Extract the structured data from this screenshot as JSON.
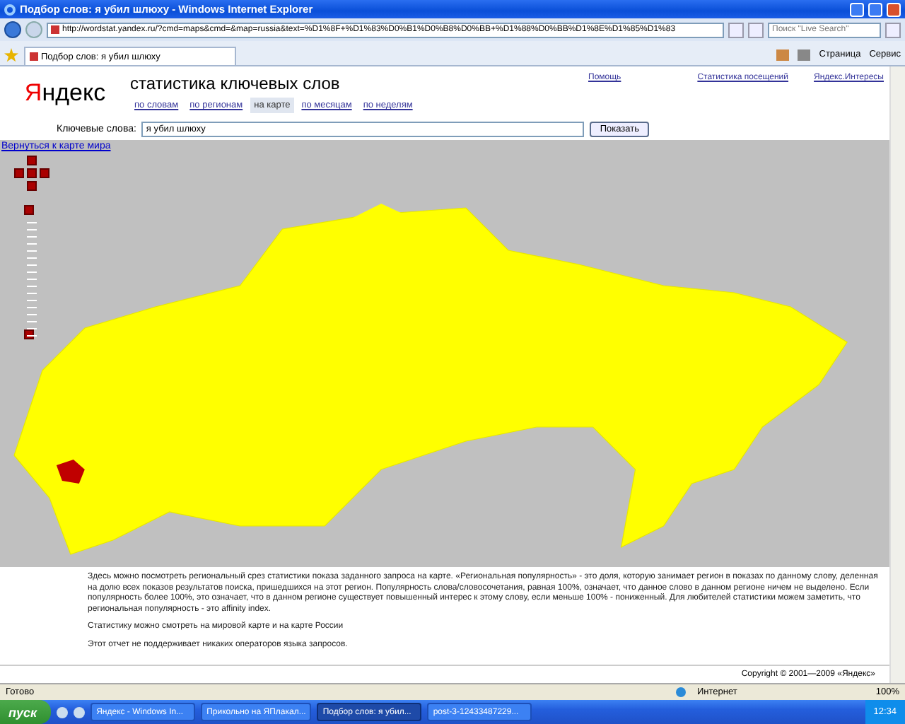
{
  "window": {
    "title": "Подбор слов: я убил шлюху - Windows Internet Explorer"
  },
  "address_bar": {
    "url": "http://wordstat.yandex.ru/?cmd=maps&cmd=&map=russia&text=%D1%8F+%D1%83%D0%B1%D0%B8%D0%BB+%D1%88%D0%BB%D1%8E%D1%85%D1%83",
    "search_placeholder": "Поиск \"Live Search\""
  },
  "tab": {
    "title": "Подбор слов: я убил шлюху"
  },
  "toolbar": {
    "items": [
      "Страница",
      "Сервис"
    ]
  },
  "page": {
    "logo": "Яндекс",
    "title": "статистика ключевых слов",
    "top_links": [
      "Помощь",
      "Статистика посещений",
      "Яндекс.Интересы"
    ],
    "nav": [
      {
        "label": "по словам",
        "selected": false
      },
      {
        "label": "по регионам",
        "selected": false
      },
      {
        "label": "на карте",
        "selected": true
      },
      {
        "label": "по месяцам",
        "selected": false
      },
      {
        "label": "по неделям",
        "selected": false
      }
    ],
    "keyword_label": "Ключевые слова:",
    "keyword_value": "я убил шлюху",
    "submit": "Показать",
    "back_link": "Вернуться к карте мира",
    "paragraphs": [
      "Здесь можно посмотреть региональный срез статистики показа заданного запроса на карте. «Региональная популярность» - это доля, которую занимает регион в показах по данному слову, деленная на долю всех показов результатов поиска, пришедшихся на этот регион. Популярность слова/словосочетания, равная 100%, означает, что данное слово в данном регионе ничем не выделено. Если популярность более 100%, это означает, что в данном регионе существует повышенный интерес к этому слову, если меньше 100% - пониженный. Для любителей статистики можем заметить, что региональная популярность - это affinity index.",
      "Статистику можно смотреть на мировой карте и на карте России",
      "Этот отчет не поддерживает никаких операторов языка запросов."
    ],
    "copyright": "Copyright © 2001—2009 «Яндекс»"
  },
  "status_bar": {
    "text": "Готово",
    "zone": "Интернет",
    "zoom": "100%"
  },
  "taskbar": {
    "start": "пуск",
    "tasks": [
      {
        "label": "Яндекс - Windows In...",
        "selected": false
      },
      {
        "label": "Прикольно на ЯПлакал...",
        "selected": false
      },
      {
        "label": "Подбор слов: я убил...",
        "selected": true
      },
      {
        "label": "post-3-12433487229...",
        "selected": false
      }
    ],
    "clock": "12:34"
  }
}
